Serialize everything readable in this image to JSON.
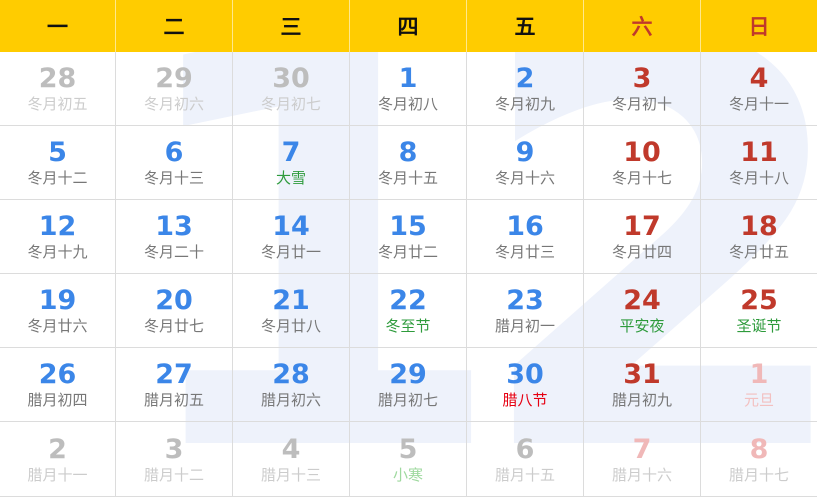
{
  "watermark": "12",
  "colors": {
    "header_bg": "#ffcc00",
    "weekday_number": "#3b86e8",
    "weekend_number": "#c0392b",
    "muted_weekday_number": "#bdbdbd",
    "muted_weekend_number": "#f0b8b8",
    "lunar_text": "#777777",
    "muted_lunar_text": "#cccccc",
    "term_text": "#2e9b3c",
    "muted_term_text": "#9fd99f",
    "festival_red": "#e60012",
    "muted_festival_red": "#f3c0c0"
  },
  "weekdays": [
    {
      "label": "一",
      "weekend": false
    },
    {
      "label": "二",
      "weekend": false
    },
    {
      "label": "三",
      "weekend": false
    },
    {
      "label": "四",
      "weekend": false
    },
    {
      "label": "五",
      "weekend": false
    },
    {
      "label": "六",
      "weekend": true
    },
    {
      "label": "日",
      "weekend": true
    }
  ],
  "days": [
    {
      "num": "28",
      "lunar": "冬月初五",
      "muted": true,
      "weekend": false,
      "kind": "lunar"
    },
    {
      "num": "29",
      "lunar": "冬月初六",
      "muted": true,
      "weekend": false,
      "kind": "lunar"
    },
    {
      "num": "30",
      "lunar": "冬月初七",
      "muted": true,
      "weekend": false,
      "kind": "lunar"
    },
    {
      "num": "1",
      "lunar": "冬月初八",
      "muted": false,
      "weekend": false,
      "kind": "lunar"
    },
    {
      "num": "2",
      "lunar": "冬月初九",
      "muted": false,
      "weekend": false,
      "kind": "lunar"
    },
    {
      "num": "3",
      "lunar": "冬月初十",
      "muted": false,
      "weekend": true,
      "kind": "lunar"
    },
    {
      "num": "4",
      "lunar": "冬月十一",
      "muted": false,
      "weekend": true,
      "kind": "lunar"
    },
    {
      "num": "5",
      "lunar": "冬月十二",
      "muted": false,
      "weekend": false,
      "kind": "lunar"
    },
    {
      "num": "6",
      "lunar": "冬月十三",
      "muted": false,
      "weekend": false,
      "kind": "lunar"
    },
    {
      "num": "7",
      "lunar": "大雪",
      "muted": false,
      "weekend": false,
      "kind": "term"
    },
    {
      "num": "8",
      "lunar": "冬月十五",
      "muted": false,
      "weekend": false,
      "kind": "lunar"
    },
    {
      "num": "9",
      "lunar": "冬月十六",
      "muted": false,
      "weekend": false,
      "kind": "lunar"
    },
    {
      "num": "10",
      "lunar": "冬月十七",
      "muted": false,
      "weekend": true,
      "kind": "lunar"
    },
    {
      "num": "11",
      "lunar": "冬月十八",
      "muted": false,
      "weekend": true,
      "kind": "lunar"
    },
    {
      "num": "12",
      "lunar": "冬月十九",
      "muted": false,
      "weekend": false,
      "kind": "lunar"
    },
    {
      "num": "13",
      "lunar": "冬月二十",
      "muted": false,
      "weekend": false,
      "kind": "lunar"
    },
    {
      "num": "14",
      "lunar": "冬月廿一",
      "muted": false,
      "weekend": false,
      "kind": "lunar"
    },
    {
      "num": "15",
      "lunar": "冬月廿二",
      "muted": false,
      "weekend": false,
      "kind": "lunar"
    },
    {
      "num": "16",
      "lunar": "冬月廿三",
      "muted": false,
      "weekend": false,
      "kind": "lunar"
    },
    {
      "num": "17",
      "lunar": "冬月廿四",
      "muted": false,
      "weekend": true,
      "kind": "lunar"
    },
    {
      "num": "18",
      "lunar": "冬月廿五",
      "muted": false,
      "weekend": true,
      "kind": "lunar"
    },
    {
      "num": "19",
      "lunar": "冬月廿六",
      "muted": false,
      "weekend": false,
      "kind": "lunar"
    },
    {
      "num": "20",
      "lunar": "冬月廿七",
      "muted": false,
      "weekend": false,
      "kind": "lunar"
    },
    {
      "num": "21",
      "lunar": "冬月廿八",
      "muted": false,
      "weekend": false,
      "kind": "lunar"
    },
    {
      "num": "22",
      "lunar": "冬至节",
      "muted": false,
      "weekend": false,
      "kind": "term"
    },
    {
      "num": "23",
      "lunar": "腊月初一",
      "muted": false,
      "weekend": false,
      "kind": "lunar"
    },
    {
      "num": "24",
      "lunar": "平安夜",
      "muted": false,
      "weekend": true,
      "kind": "term"
    },
    {
      "num": "25",
      "lunar": "圣诞节",
      "muted": false,
      "weekend": true,
      "kind": "term"
    },
    {
      "num": "26",
      "lunar": "腊月初四",
      "muted": false,
      "weekend": false,
      "kind": "lunar"
    },
    {
      "num": "27",
      "lunar": "腊月初五",
      "muted": false,
      "weekend": false,
      "kind": "lunar"
    },
    {
      "num": "28",
      "lunar": "腊月初六",
      "muted": false,
      "weekend": false,
      "kind": "lunar"
    },
    {
      "num": "29",
      "lunar": "腊月初七",
      "muted": false,
      "weekend": false,
      "kind": "lunar"
    },
    {
      "num": "30",
      "lunar": "腊八节",
      "muted": false,
      "weekend": false,
      "kind": "festival"
    },
    {
      "num": "31",
      "lunar": "腊月初九",
      "muted": false,
      "weekend": true,
      "kind": "lunar"
    },
    {
      "num": "1",
      "lunar": "元旦",
      "muted": true,
      "weekend": true,
      "kind": "festival"
    },
    {
      "num": "2",
      "lunar": "腊月十一",
      "muted": true,
      "weekend": false,
      "kind": "lunar"
    },
    {
      "num": "3",
      "lunar": "腊月十二",
      "muted": true,
      "weekend": false,
      "kind": "lunar"
    },
    {
      "num": "4",
      "lunar": "腊月十三",
      "muted": true,
      "weekend": false,
      "kind": "lunar"
    },
    {
      "num": "5",
      "lunar": "小寒",
      "muted": true,
      "weekend": false,
      "kind": "term"
    },
    {
      "num": "6",
      "lunar": "腊月十五",
      "muted": true,
      "weekend": false,
      "kind": "lunar"
    },
    {
      "num": "7",
      "lunar": "腊月十六",
      "muted": true,
      "weekend": true,
      "kind": "lunar"
    },
    {
      "num": "8",
      "lunar": "腊月十七",
      "muted": true,
      "weekend": true,
      "kind": "lunar"
    }
  ]
}
